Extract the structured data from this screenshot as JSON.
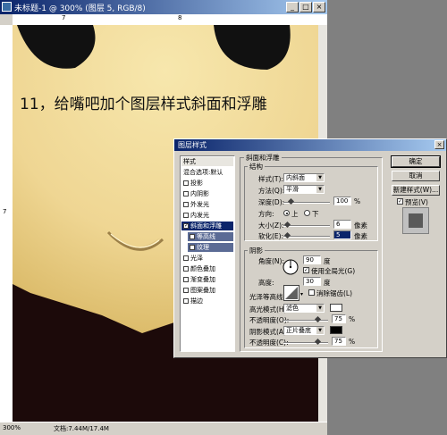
{
  "document": {
    "title": "未标题-1 @ 300% (图层 5, RGB/8)",
    "status_zoom": "300%",
    "status_doc": "文档:7.44M/17.4M",
    "ruler_h": [
      "7",
      "8"
    ],
    "ruler_v": [
      "7"
    ]
  },
  "caption": "11，给嘴吧加个图层样式斜面和浮雕",
  "dialog": {
    "title": "图层样式",
    "styles_header": "样式",
    "blend_options": "混合选项:默认",
    "effects": [
      {
        "label": "投影",
        "checked": false
      },
      {
        "label": "内阴影",
        "checked": false
      },
      {
        "label": "外发光",
        "checked": false
      },
      {
        "label": "内发光",
        "checked": false
      },
      {
        "label": "斜面和浮雕",
        "checked": true
      },
      {
        "label": "等高线",
        "checked": false
      },
      {
        "label": "纹理",
        "checked": false
      },
      {
        "label": "光泽",
        "checked": false
      },
      {
        "label": "颜色叠加",
        "checked": false
      },
      {
        "label": "渐变叠加",
        "checked": false
      },
      {
        "label": "图案叠加",
        "checked": false
      },
      {
        "label": "描边",
        "checked": false
      }
    ],
    "section_title": "斜面和浮雕",
    "structure": {
      "title": "结构",
      "style_label": "样式(T):",
      "style_value": "内斜面",
      "technique_label": "方法(Q):",
      "technique_value": "平滑",
      "depth_label": "深度(D):",
      "depth_value": "100",
      "depth_unit": "%",
      "direction_label": "方向:",
      "dir_up": "上",
      "dir_down": "下",
      "size_label": "大小(Z):",
      "size_value": "6",
      "size_unit": "像素",
      "soften_label": "软化(E):",
      "soften_value": "5",
      "soften_unit": "像素"
    },
    "shading": {
      "title": "阴影",
      "angle_label": "角度(N):",
      "angle_value": "90",
      "angle_unit": "度",
      "global_light_label": "使用全局光(G)",
      "altitude_label": "高度:",
      "altitude_value": "30",
      "altitude_unit": "度",
      "gloss_label": "光泽等高线:",
      "antialias_label": "消除锯齿(L)",
      "highlight_mode_label": "高光模式(H):",
      "highlight_mode_value": "滤色",
      "highlight_opacity_label": "不透明度(O):",
      "highlight_opacity_value": "75",
      "shadow_mode_label": "阴影模式(A):",
      "shadow_mode_value": "正片叠底",
      "shadow_opacity_label": "不透明度(C):",
      "shadow_opacity_value": "75",
      "percent": "%"
    },
    "buttons": {
      "ok": "确定",
      "cancel": "取消",
      "new_style": "新建样式(W)...",
      "preview": "预览(V)"
    }
  },
  "colors": {
    "face": "#f5e3a6",
    "hair": "#141414",
    "body": "#2a0a0a",
    "title_start": "#0a246a",
    "title_end": "#a6caf0"
  }
}
